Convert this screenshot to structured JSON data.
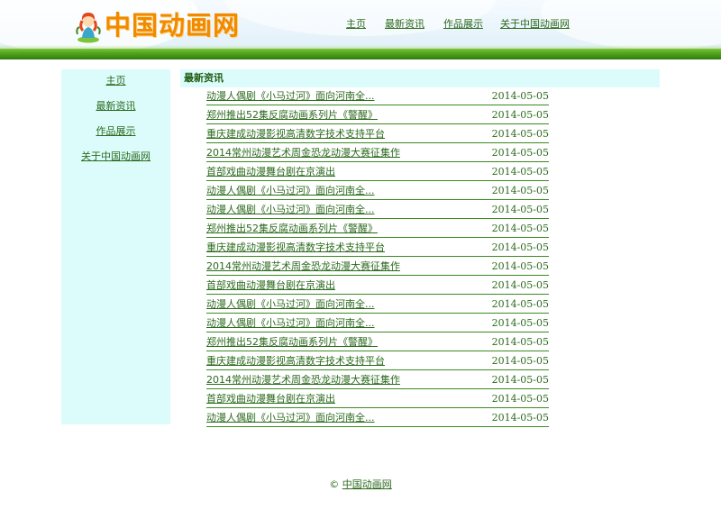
{
  "header": {
    "logo_text": "中国动画网",
    "nav": [
      {
        "label": "主页"
      },
      {
        "label": "最新资讯"
      },
      {
        "label": "作品展示"
      },
      {
        "label": "关于中国动画网"
      }
    ]
  },
  "sidebar": {
    "items": [
      {
        "label": "主页"
      },
      {
        "label": "最新资讯"
      },
      {
        "label": "作品展示"
      },
      {
        "label": "关于中国动画网"
      }
    ]
  },
  "main": {
    "title": "最新资讯",
    "news": [
      {
        "title": "动漫人偶剧《小马过河》面向河南全...",
        "date": "2014-05-05"
      },
      {
        "title": "郑州推出52集反腐动画系列片《警醒》",
        "date": "2014-05-05"
      },
      {
        "title": "重庆建成动漫影视高清数字技术支持平台",
        "date": "2014-05-05"
      },
      {
        "title": "2014常州动漫艺术周金恐龙动漫大赛征集作",
        "date": "2014-05-05"
      },
      {
        "title": "首部戏曲动漫舞台剧在京演出",
        "date": "2014-05-05"
      },
      {
        "title": "动漫人偶剧《小马过河》面向河南全...",
        "date": "2014-05-05"
      },
      {
        "title": "动漫人偶剧《小马过河》面向河南全...",
        "date": "2014-05-05"
      },
      {
        "title": "郑州推出52集反腐动画系列片《警醒》",
        "date": "2014-05-05"
      },
      {
        "title": "重庆建成动漫影视高清数字技术支持平台",
        "date": "2014-05-05"
      },
      {
        "title": "2014常州动漫艺术周金恐龙动漫大赛征集作",
        "date": "2014-05-05"
      },
      {
        "title": "首部戏曲动漫舞台剧在京演出",
        "date": "2014-05-05"
      },
      {
        "title": "动漫人偶剧《小马过河》面向河南全...",
        "date": "2014-05-05"
      },
      {
        "title": "动漫人偶剧《小马过河》面向河南全...",
        "date": "2014-05-05"
      },
      {
        "title": "郑州推出52集反腐动画系列片《警醒》",
        "date": "2014-05-05"
      },
      {
        "title": "重庆建成动漫影视高清数字技术支持平台",
        "date": "2014-05-05"
      },
      {
        "title": "2014常州动漫艺术周金恐龙动漫大赛征集作",
        "date": "2014-05-05"
      },
      {
        "title": "首部戏曲动漫舞台剧在京演出",
        "date": "2014-05-05"
      },
      {
        "title": "动漫人偶剧《小马过河》面向河南全...",
        "date": "2014-05-05"
      }
    ]
  },
  "footer": {
    "copyright_symbol": "©",
    "site_link": "中国动画网"
  },
  "colors": {
    "link_green": "#2b6a1c",
    "panel_cyan": "#dcfcfb",
    "header_band_green": "#4fa21c",
    "logo_orange": "#f28a00"
  }
}
